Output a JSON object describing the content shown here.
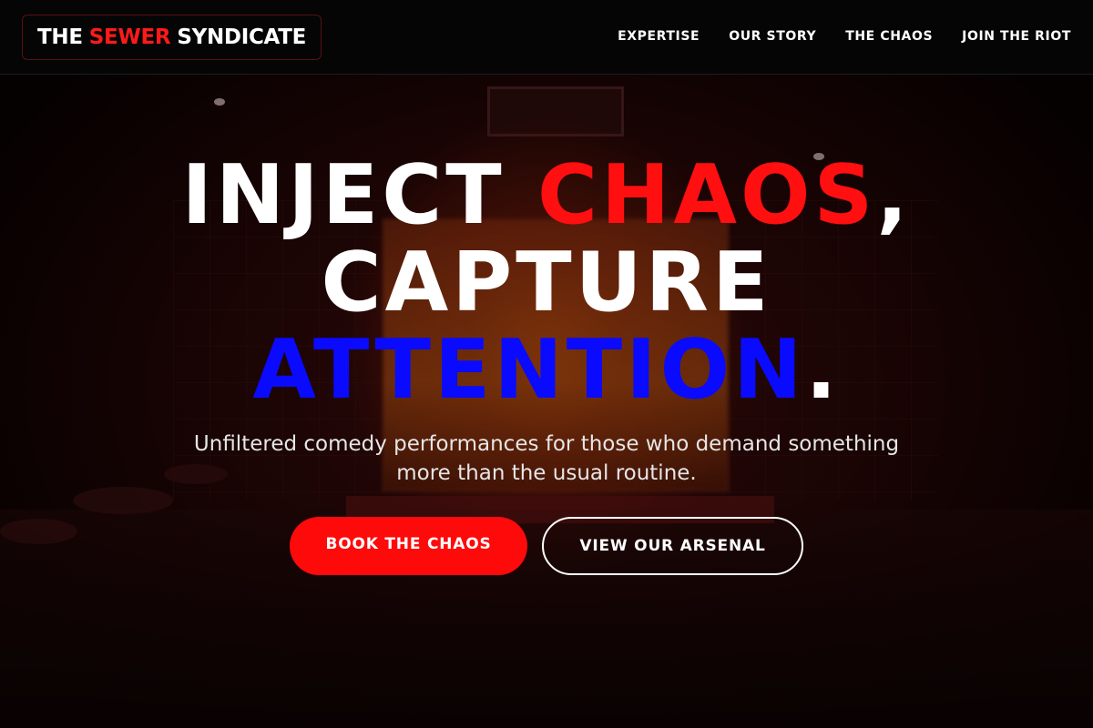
{
  "brand": {
    "part1": "THE",
    "part2": "SEWER",
    "part3": "SYNDICATE",
    "accent_color": "#ff1a1a"
  },
  "nav": {
    "items": [
      {
        "label": "EXPERTISE"
      },
      {
        "label": "OUR STORY"
      },
      {
        "label": "THE CHAOS"
      },
      {
        "label": "JOIN THE RIOT"
      }
    ]
  },
  "hero": {
    "headline": {
      "line1_a": "INJECT ",
      "line1_b": "CHAOS",
      "line1_c": ",",
      "line2": "CAPTURE",
      "line3_a": "ATTENTION",
      "line3_b": "."
    },
    "subtitle": "Unfiltered comedy performances for those who demand something more than the usual routine.",
    "primary_button": "BOOK THE CHAOS",
    "secondary_button": "VIEW OUR ARSENAL"
  },
  "colors": {
    "red": "#ff0f0f",
    "blue": "#0a0aff",
    "white": "#ffffff",
    "background": "#000000"
  }
}
